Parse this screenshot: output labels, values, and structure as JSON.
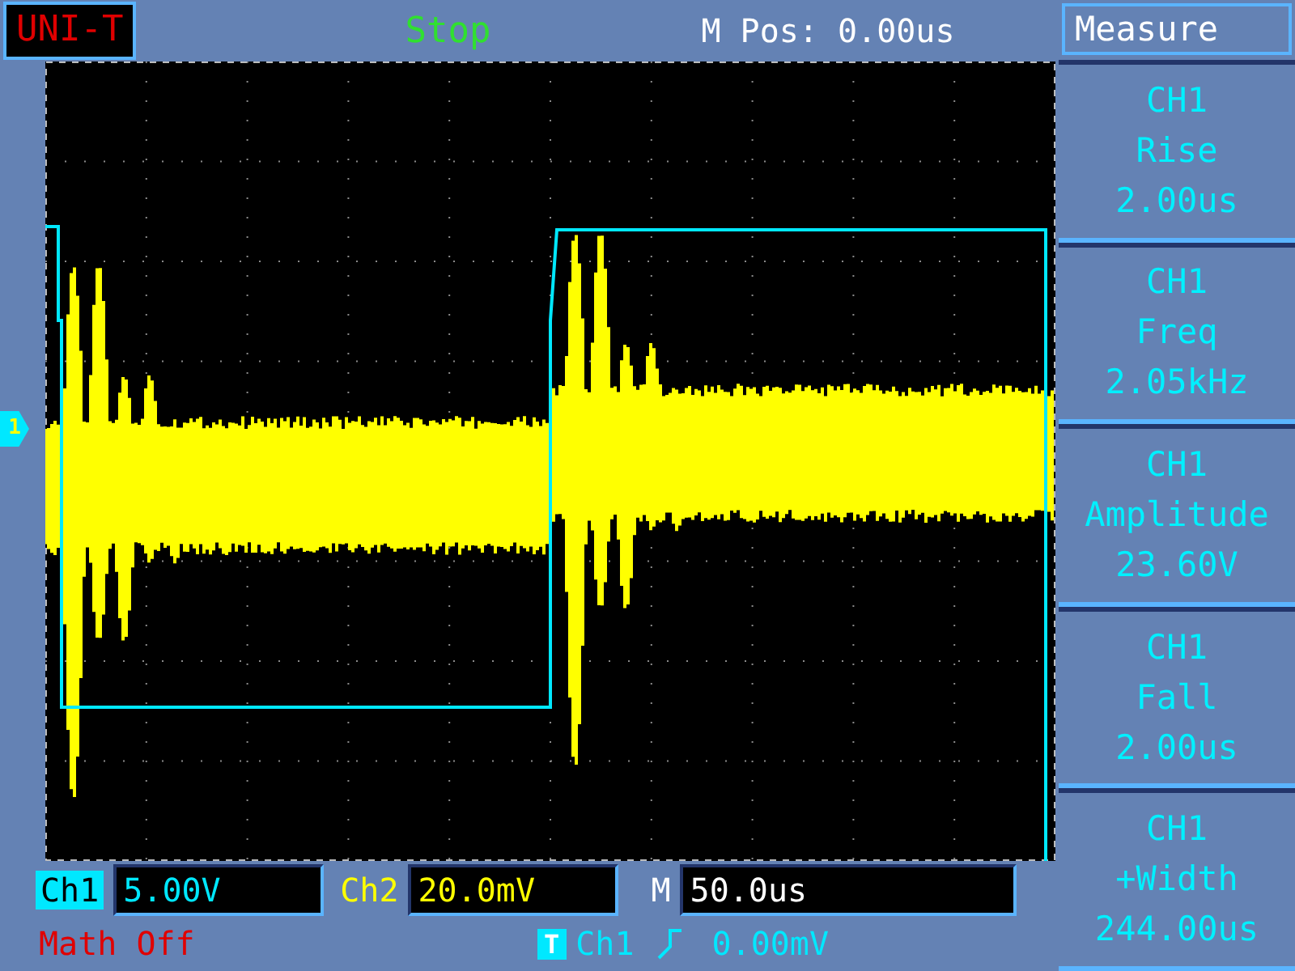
{
  "brand": "UNI-T",
  "run_state": "Stop",
  "m_pos": "M Pos: 0.00us",
  "menu": {
    "title": "Measure",
    "items": [
      {
        "channel": "CH1",
        "label": "Rise",
        "value": "2.00us"
      },
      {
        "channel": "CH1",
        "label": "Freq",
        "value": "2.05kHz"
      },
      {
        "channel": "CH1",
        "label": "Amplitude",
        "value": "23.60V"
      },
      {
        "channel": "CH1",
        "label": "Fall",
        "value": "2.00us"
      },
      {
        "channel": "CH1",
        "label": "+Width",
        "value": "244.00us"
      }
    ]
  },
  "channel_marker": "1",
  "ch1": {
    "label": "Ch1",
    "scale": "5.00V"
  },
  "ch2": {
    "label": "Ch2",
    "scale": "20.0mV"
  },
  "timebase": {
    "label": "M",
    "scale": "50.0us"
  },
  "math": "Math Off",
  "trigger": {
    "badge": "T",
    "source": "Ch1",
    "level": "0.00mV"
  }
}
